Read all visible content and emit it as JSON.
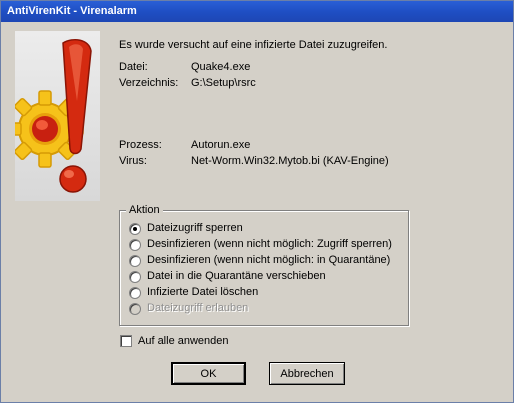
{
  "window": {
    "title": "AntiVirenKit - Virenalarm"
  },
  "message": "Es wurde versucht auf eine infizierte Datei zuzugreifen.",
  "details": [
    {
      "label": "Datei:",
      "value": "Quake4.exe"
    },
    {
      "label": "Verzeichnis:",
      "value": "G:\\Setup\\rsrc"
    },
    {
      "label": "Prozess:",
      "value": "Autorun.exe"
    },
    {
      "label": "Virus:",
      "value": "Net-Worm.Win32.Mytob.bi (KAV-Engine)"
    }
  ],
  "action": {
    "legend": "Aktion",
    "options": [
      {
        "label": "Dateizugriff sperren"
      },
      {
        "label": "Desinfizieren (wenn nicht möglich: Zugriff sperren)"
      },
      {
        "label": "Desinfizieren (wenn nicht möglich: in Quarantäne)"
      },
      {
        "label": "Datei in die Quarantäne verschieben"
      },
      {
        "label": "Infizierte Datei löschen"
      },
      {
        "label": "Dateizugriff erlauben"
      }
    ]
  },
  "apply_all": {
    "label": "Auf alle anwenden",
    "checked": false
  },
  "buttons": {
    "ok": "OK",
    "cancel": "Abbrechen"
  },
  "colors": {
    "titlebar": "#1f4fc4",
    "dialog": "#d4d0c8",
    "logo_red": "#d42a10",
    "logo_yellow": "#f6c21a"
  }
}
